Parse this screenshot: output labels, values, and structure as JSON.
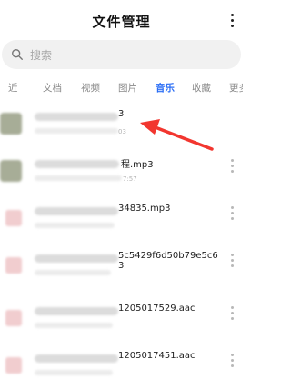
{
  "header": {
    "title": "文件管理"
  },
  "search": {
    "placeholder": "搜索"
  },
  "tabs": [
    {
      "label": "最近",
      "visible_text": "近"
    },
    {
      "label": "文档",
      "visible_text": "文档"
    },
    {
      "label": "视频",
      "visible_text": "视频"
    },
    {
      "label": "图片",
      "visible_text": "图片"
    },
    {
      "label": "音乐",
      "visible_text": "音乐"
    },
    {
      "label": "收藏",
      "visible_text": "收藏"
    },
    {
      "label": "更多",
      "visible_text": "更多"
    }
  ],
  "files": [
    {
      "name_tail": "3",
      "meta_tail": "03"
    },
    {
      "name_tail": "程.mp3",
      "meta_tail": "7:57"
    },
    {
      "name_tail": "34835.mp3",
      "meta_tail": ""
    },
    {
      "name_tail_line1": "5c5429f6d50b79e5c6",
      "name_tail_line2": "3",
      "meta_tail": ""
    },
    {
      "name_tail": "1205017529.aac",
      "meta_tail": ""
    },
    {
      "name_tail": "1205017451.aac",
      "meta_tail": ""
    }
  ],
  "colors": {
    "accent": "#2a6df5",
    "arrow": "#f2362f",
    "search_bg": "#f1f1f1"
  },
  "icons": {
    "search": "search-icon",
    "more": "more-vertical-icon",
    "arrow": "red-arrow-annotation"
  }
}
